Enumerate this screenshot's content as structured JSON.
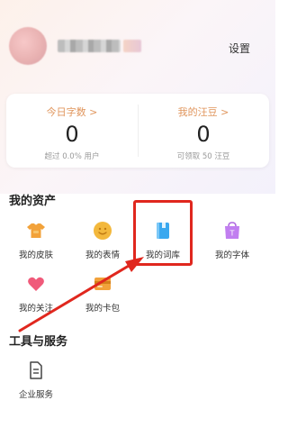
{
  "header": {
    "settings_label": "设置"
  },
  "stats": [
    {
      "title": "今日字数 >",
      "value": "0",
      "sub": "超过 0.0% 用户"
    },
    {
      "title": "我的汪豆 >",
      "value": "0",
      "sub": "可领取 50 汪豆"
    }
  ],
  "assets": {
    "title": "我的资产",
    "items": [
      {
        "label": "我的皮肤",
        "icon": "tshirt-icon"
      },
      {
        "label": "我的表情",
        "icon": "smiley-icon"
      },
      {
        "label": "我的词库",
        "icon": "book-icon"
      },
      {
        "label": "我的字体",
        "icon": "shopping-bag-icon"
      },
      {
        "label": "我的关注",
        "icon": "heart-icon"
      },
      {
        "label": "我的卡包",
        "icon": "card-wallet-icon"
      }
    ]
  },
  "tools": {
    "title": "工具与服务",
    "items": [
      {
        "label": "企业服务",
        "icon": "document-icon"
      }
    ]
  },
  "colors": {
    "accent_orange": "#e0955c",
    "highlight_red": "#e0271e"
  }
}
